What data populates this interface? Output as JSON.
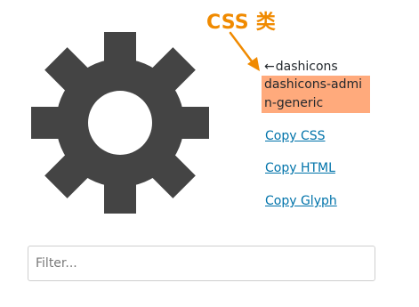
{
  "annotation": {
    "label": "CSS 类",
    "color": "#f08a00"
  },
  "icon": {
    "name": "gear-icon",
    "color": "#444444"
  },
  "info": {
    "arrow": "←",
    "alias": "dashicons",
    "class_name": "dashicons-admin-generic",
    "highlight_color": "#ffaa7c"
  },
  "links": {
    "copy_css": "Copy CSS",
    "copy_html": "Copy HTML",
    "copy_glyph": "Copy Glyph",
    "color": "#0073aa"
  },
  "filter": {
    "placeholder": "Filter..."
  }
}
